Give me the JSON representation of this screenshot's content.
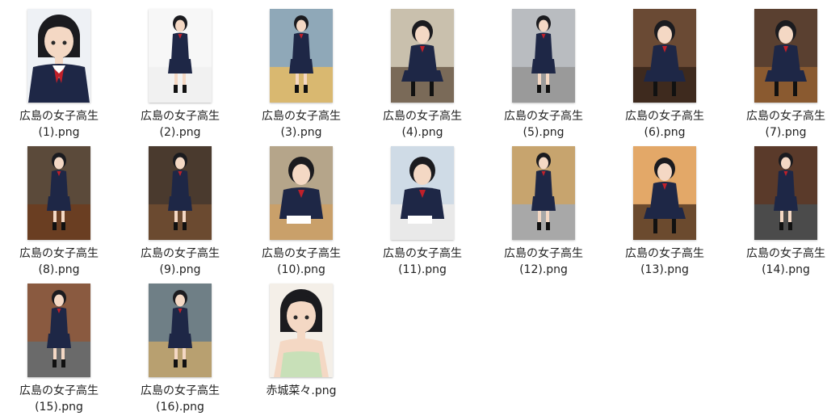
{
  "files": [
    {
      "line1": "広島の女子高生",
      "line2": "(1).png",
      "thumb_icon": "schoolgirl-portrait-thumbnail",
      "scene": "portrait",
      "bg": "#eef1f5",
      "ground": "#ffffff"
    },
    {
      "line1": "広島の女子高生",
      "line2": "(2).png",
      "thumb_icon": "schoolgirl-full-body-thumbnail",
      "scene": "full",
      "bg": "#f7f7f7",
      "ground": "#f1f1f1"
    },
    {
      "line1": "広島の女子高生",
      "line2": "(3).png",
      "thumb_icon": "schoolgirl-station-thumbnail",
      "scene": "full",
      "bg": "#8fa8b8",
      "ground": "#d9b870"
    },
    {
      "line1": "広島の女子高生",
      "line2": "(4).png",
      "thumb_icon": "schoolgirl-classroom-thumbnail",
      "scene": "sitting",
      "bg": "#c9c0ad",
      "ground": "#7a6a58"
    },
    {
      "line1": "広島の女子高生",
      "line2": "(5).png",
      "thumb_icon": "schoolgirl-arcade-thumbnail",
      "scene": "full",
      "bg": "#b9bcc0",
      "ground": "#9a9a9a"
    },
    {
      "line1": "広島の女子高生",
      "line2": "(6).png",
      "thumb_icon": "schoolgirl-restaurant-thumbnail",
      "scene": "sitting",
      "bg": "#6a4a34",
      "ground": "#3e2a1e"
    },
    {
      "line1": "広島の女子高生",
      "line2": "(7).png",
      "thumb_icon": "schoolgirl-okonomiyaki-thumbnail",
      "scene": "sitting",
      "bg": "#5a4030",
      "ground": "#8a5a30"
    },
    {
      "line1": "広島の女子高生",
      "line2": "(8).png",
      "thumb_icon": "schoolgirl-cafe-counter-thumbnail",
      "scene": "full",
      "bg": "#5b4a3a",
      "ground": "#6a3e22"
    },
    {
      "line1": "広島の女子高生",
      "line2": "(9).png",
      "thumb_icon": "schoolgirl-shop-thumbnail",
      "scene": "full",
      "bg": "#4a3a2e",
      "ground": "#6b4a30"
    },
    {
      "line1": "広島の女子高生",
      "line2": "(10).png",
      "thumb_icon": "schoolgirl-library-thumbnail",
      "scene": "desk",
      "bg": "#b5a58a",
      "ground": "#c9a06a"
    },
    {
      "line1": "広島の女子高生",
      "line2": "(11).png",
      "thumb_icon": "schoolgirl-desk-thumbnail",
      "scene": "desk",
      "bg": "#cfdbe6",
      "ground": "#e9e9e9"
    },
    {
      "line1": "広島の女子高生",
      "line2": "(12).png",
      "thumb_icon": "schoolgirl-storefront-thumbnail",
      "scene": "full",
      "bg": "#c7a46e",
      "ground": "#a8a8a8"
    },
    {
      "line1": "広島の女子高生",
      "line2": "(13).png",
      "thumb_icon": "schoolgirl-sunset-bench-thumbnail",
      "scene": "sitting",
      "bg": "#e3a868",
      "ground": "#6b4a2e"
    },
    {
      "line1": "広島の女子高生",
      "line2": "(14).png",
      "thumb_icon": "schoolgirl-street-stall-thumbnail",
      "scene": "full",
      "bg": "#5a3a2a",
      "ground": "#4b4b4b"
    },
    {
      "line1": "広島の女子高生",
      "line2": "(15).png",
      "thumb_icon": "schoolgirl-shop-street-thumbnail",
      "scene": "full",
      "bg": "#8a5a40",
      "ground": "#6a6a6a"
    },
    {
      "line1": "広島の女子高生",
      "line2": "(16).png",
      "thumb_icon": "schoolgirl-tram-stop-thumbnail",
      "scene": "full",
      "bg": "#6f7f86",
      "ground": "#b8a070"
    },
    {
      "line1": "赤城菜々.png",
      "line2": "",
      "thumb_icon": "girl-sundress-portrait-thumbnail",
      "scene": "dress",
      "bg": "#f4efe8",
      "ground": "#f4efe8"
    }
  ]
}
